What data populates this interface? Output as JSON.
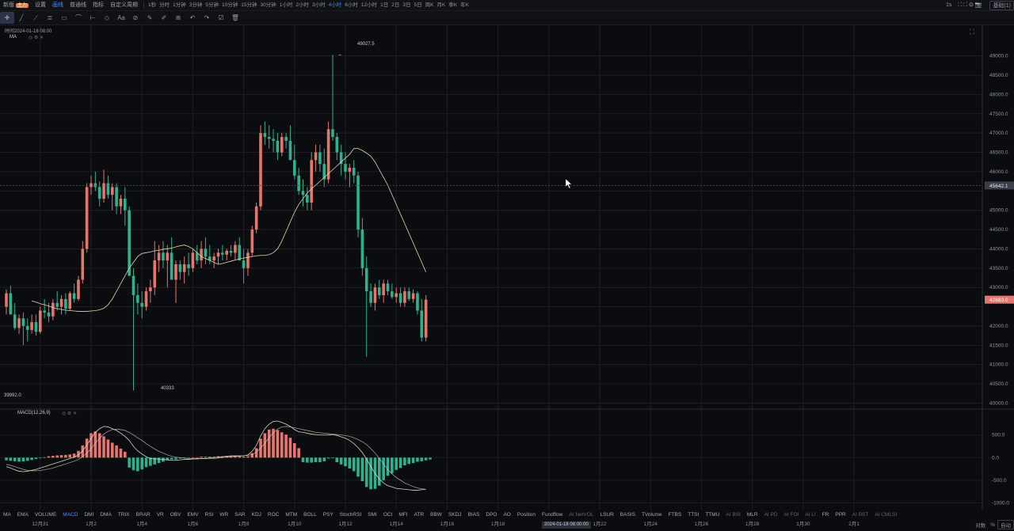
{
  "topbar": {
    "left_items": [
      {
        "label": "新版",
        "badge": "主力"
      },
      {
        "label": "设置"
      },
      {
        "label": "画线",
        "active": true
      },
      {
        "label": "普通线"
      },
      {
        "label": "指标"
      },
      {
        "label": "自定义周期"
      }
    ],
    "intervals": [
      "1秒",
      "分时",
      "1分钟",
      "3分钟",
      "5分钟",
      "10分钟",
      "15分钟",
      "30分钟",
      "1小时",
      "2小时",
      "3小时",
      "4小时",
      "6小时",
      "12小时",
      "1日",
      "2日",
      "3日",
      "5日",
      "周K",
      "月K",
      "季K",
      "年K"
    ],
    "active_interval": "4小时",
    "right_items": [
      "1s"
    ],
    "right_box": "基础(1)"
  },
  "chart_header": {
    "time_label": "时间2024-01-18 08:00",
    "ma_label": "MA",
    "max_price_label": "49027.5",
    "min_price_label": "40333",
    "last_low_label": "39992.0",
    "macd_label": "MACD(12,26,9)"
  },
  "chart_data": {
    "type": "candlestick",
    "title": "",
    "price_axis": {
      "ticks": [
        49000,
        48500,
        48000,
        47500,
        47000,
        46500,
        46000,
        45500,
        45000,
        44500,
        44000,
        43500,
        43000,
        42500,
        42000,
        41500,
        41000,
        40500,
        40000
      ],
      "tick_labels": [
        "49000.0",
        "48500.0",
        "48000.0",
        "47500.0",
        "47000.0",
        "46500.0",
        "46000.0",
        "45642.1",
        "45000.0",
        "44500.0",
        "44000.0",
        "43500.0",
        "43000.0",
        "42683.0",
        "42000.0",
        "41500.0",
        "41000.0",
        "40500.0",
        "40000.0"
      ],
      "range": [
        39990,
        49300
      ],
      "crosshair_price": "45642.1",
      "crosshair_value": 45642.1,
      "last_price": "42683.0",
      "last_value": 42683
    },
    "macd_axis": {
      "ticks": [
        500,
        0,
        -500,
        -1000
      ],
      "tick_labels": [
        "500.0",
        "0.0",
        "-500.0",
        "-1000.0"
      ],
      "range": [
        -1150,
        950
      ]
    },
    "date_ticks": [
      {
        "label": "12月31",
        "index": 8
      },
      {
        "label": "1月2",
        "index": 20
      },
      {
        "label": "1月4",
        "index": 32
      },
      {
        "label": "1月6",
        "index": 44
      },
      {
        "label": "1月8",
        "index": 56
      },
      {
        "label": "1月10",
        "index": 68
      },
      {
        "label": "1月12",
        "index": 80
      },
      {
        "label": "1月14",
        "index": 92
      },
      {
        "label": "1月16",
        "index": 104
      },
      {
        "label": "1月18",
        "index": 116
      },
      {
        "label": "1月20",
        "index": 128
      },
      {
        "label": "1月22",
        "index": 140
      },
      {
        "label": "1月24",
        "index": 152
      },
      {
        "label": "1月26",
        "index": 164
      },
      {
        "label": "1月28",
        "index": 176
      },
      {
        "label": "1月30",
        "index": 188
      },
      {
        "label": "2月1",
        "index": 200
      }
    ],
    "cursor_date": "2024-01-18 08:00:00",
    "candles": [
      [
        42500,
        42950,
        42300,
        42850
      ],
      [
        42850,
        43050,
        42700,
        42300
      ],
      [
        42300,
        42600,
        41900,
        41950
      ],
      [
        41950,
        42300,
        41800,
        42200
      ],
      [
        42200,
        42350,
        41500,
        42000
      ],
      [
        42000,
        42200,
        41600,
        41900
      ],
      [
        41900,
        42300,
        41800,
        42100
      ],
      [
        42100,
        42300,
        41750,
        41850
      ],
      [
        41850,
        42500,
        41800,
        42400
      ],
      [
        42400,
        42700,
        42200,
        42350
      ],
      [
        42350,
        42600,
        42100,
        42250
      ],
      [
        42250,
        42700,
        42150,
        42600
      ],
      [
        42600,
        42900,
        42400,
        42500
      ],
      [
        42500,
        42800,
        42300,
        42700
      ],
      [
        42700,
        42850,
        42300,
        42450
      ],
      [
        42450,
        42900,
        42400,
        42850
      ],
      [
        42850,
        43100,
        42600,
        42700
      ],
      [
        42700,
        43300,
        42650,
        43200
      ],
      [
        43200,
        44200,
        43100,
        44000
      ],
      [
        44000,
        45700,
        43900,
        45600
      ],
      [
        45600,
        45900,
        45400,
        45700
      ],
      [
        45700,
        46000,
        45500,
        45600
      ],
      [
        45600,
        45750,
        45100,
        45300
      ],
      [
        45300,
        46050,
        45200,
        45700
      ],
      [
        45700,
        45900,
        45300,
        45400
      ],
      [
        45400,
        45700,
        45000,
        45600
      ],
      [
        45600,
        45700,
        44900,
        45100
      ],
      [
        45100,
        45400,
        44900,
        45300
      ],
      [
        45300,
        45600,
        44600,
        45000
      ],
      [
        45000,
        45100,
        43400,
        43300
      ],
      [
        43300,
        43500,
        40333,
        42800
      ],
      [
        42800,
        43100,
        42300,
        42600
      ],
      [
        42600,
        42900,
        42200,
        42500
      ],
      [
        42500,
        43000,
        42400,
        42900
      ],
      [
        42900,
        43200,
        42600,
        43000
      ],
      [
        43000,
        44200,
        42800,
        43700
      ],
      [
        43700,
        44100,
        43400,
        43900
      ],
      [
        43900,
        44200,
        43500,
        43700
      ],
      [
        43700,
        44100,
        43000,
        43900
      ],
      [
        43900,
        44300,
        43600,
        43200
      ],
      [
        43200,
        43700,
        42600,
        43600
      ],
      [
        43600,
        43700,
        43200,
        43400
      ],
      [
        43400,
        43800,
        43100,
        43600
      ],
      [
        43600,
        43900,
        43300,
        43500
      ],
      [
        43500,
        44000,
        43400,
        43900
      ],
      [
        43900,
        44100,
        43600,
        43700
      ],
      [
        43700,
        44200,
        43500,
        44000
      ],
      [
        44000,
        44300,
        43600,
        43800
      ],
      [
        43800,
        44100,
        43600,
        43700
      ],
      [
        43700,
        43900,
        43500,
        43800
      ],
      [
        43800,
        44000,
        43600,
        43900
      ],
      [
        43900,
        44100,
        43700,
        43850
      ],
      [
        43850,
        44000,
        43700,
        43950
      ],
      [
        43950,
        44100,
        43800,
        43900
      ],
      [
        43900,
        44200,
        43700,
        44100
      ],
      [
        44100,
        44300,
        43800,
        43700
      ],
      [
        43700,
        44000,
        43100,
        43500
      ],
      [
        43500,
        44000,
        43300,
        43900
      ],
      [
        43900,
        44600,
        43800,
        44500
      ],
      [
        44500,
        45200,
        44400,
        45100
      ],
      [
        45100,
        47200,
        45000,
        47000
      ],
      [
        47000,
        47300,
        46700,
        46900
      ],
      [
        46900,
        47200,
        46600,
        46850
      ],
      [
        46850,
        47100,
        46500,
        46800
      ],
      [
        46800,
        47000,
        46300,
        46500
      ],
      [
        46500,
        47000,
        46400,
        46900
      ],
      [
        46900,
        47000,
        46600,
        46800
      ],
      [
        46800,
        47200,
        46600,
        46300
      ],
      [
        46300,
        46700,
        45800,
        45900
      ],
      [
        45900,
        46100,
        45400,
        45500
      ],
      [
        45500,
        45800,
        45100,
        45400
      ],
      [
        45400,
        45600,
        45000,
        45200
      ],
      [
        45200,
        46500,
        45000,
        46300
      ],
      [
        46300,
        46700,
        46000,
        46500
      ],
      [
        46500,
        46700,
        46000,
        46200
      ],
      [
        46200,
        46600,
        45600,
        45800
      ],
      [
        45800,
        47300,
        45700,
        47100
      ],
      [
        47100,
        49027.5,
        46800,
        46900
      ],
      [
        46900,
        47000,
        46300,
        46500
      ],
      [
        46500,
        46700,
        45900,
        46200
      ],
      [
        46200,
        46500,
        45800,
        46000
      ],
      [
        46000,
        46200,
        45600,
        46100
      ],
      [
        46100,
        46300,
        45700,
        45900
      ],
      [
        45900,
        46000,
        44300,
        44500
      ],
      [
        44500,
        44800,
        43300,
        43500
      ],
      [
        43500,
        43800,
        41200,
        42900
      ],
      [
        42900,
        43100,
        42500,
        42600
      ],
      [
        42600,
        43100,
        42400,
        43000
      ],
      [
        43000,
        43200,
        42700,
        42800
      ],
      [
        42800,
        43200,
        42600,
        43100
      ],
      [
        43100,
        43200,
        42800,
        42900
      ],
      [
        42900,
        43100,
        42700,
        42750
      ],
      [
        42750,
        43000,
        42600,
        42850
      ],
      [
        42850,
        43000,
        42500,
        42600
      ],
      [
        42600,
        43000,
        42500,
        42900
      ],
      [
        42900,
        43000,
        42650,
        42700
      ],
      [
        42700,
        42950,
        42600,
        42850
      ],
      [
        42850,
        42900,
        42300,
        42400
      ],
      [
        42400,
        42700,
        41600,
        41700
      ],
      [
        41700,
        42800,
        41600,
        42683
      ]
    ],
    "ma_series": {
      "name": "MA",
      "values": [
        42650,
        42620,
        42580,
        42550,
        42520,
        42480,
        42450,
        42430,
        42410,
        42400,
        42390,
        42380,
        42380,
        42380,
        42390,
        42400,
        42420,
        42460,
        42550,
        42700,
        42900,
        43100,
        43300,
        43500,
        43650,
        43800,
        43880,
        43900,
        43920,
        43950,
        43960,
        43990,
        44000,
        44020,
        44050,
        44080,
        44100,
        44060,
        44000,
        43900,
        43800,
        43750,
        43700,
        43650,
        43600,
        43620,
        43650,
        43680,
        43710,
        43740,
        43760,
        43780,
        43800,
        43820,
        43830,
        43830,
        43850,
        43900,
        44000,
        44200,
        44450,
        44700,
        44950,
        45150,
        45300,
        45450,
        45550,
        45650,
        45750,
        45850,
        45950,
        46050,
        46150,
        46250,
        46350,
        46450,
        46600,
        46600,
        46550,
        46480,
        46400,
        46250,
        46050,
        45850,
        45650,
        45400,
        45150,
        44900,
        44650,
        44400,
        44150,
        43900,
        43650,
        43400
      ]
    },
    "macd": {
      "hist": [
        -60,
        -70,
        -80,
        -90,
        -85,
        -70,
        -50,
        -30,
        -10,
        10,
        30,
        40,
        50,
        55,
        60,
        70,
        90,
        150,
        270,
        420,
        540,
        580,
        540,
        470,
        400,
        330,
        270,
        200,
        130,
        -220,
        -280,
        -300,
        -260,
        -210,
        -180,
        -150,
        -120,
        -90,
        -60,
        -40,
        -40,
        -20,
        -10,
        -10,
        0,
        0,
        20,
        20,
        20,
        20,
        30,
        30,
        30,
        30,
        40,
        30,
        20,
        30,
        100,
        210,
        420,
        540,
        620,
        640,
        610,
        560,
        510,
        440,
        320,
        210,
        -100,
        -110,
        -110,
        -100,
        -100,
        -80,
        -20,
        -10,
        -100,
        -150,
        -190,
        -240,
        -300,
        -420,
        -520,
        -650,
        -700,
        -690,
        -620,
        -500,
        -400,
        -350,
        -270,
        -230,
        -170,
        -140,
        -120,
        -90,
        -80,
        -60,
        -40
      ],
      "dif": [
        -200,
        -230,
        -270,
        -300,
        -310,
        -300,
        -280,
        -260,
        -230,
        -200,
        -170,
        -140,
        -110,
        -80,
        -50,
        -20,
        10,
        60,
        150,
        280,
        420,
        560,
        640,
        690,
        680,
        640,
        600,
        540,
        470,
        380,
        250,
        150,
        80,
        20,
        -20,
        -30,
        -30,
        -40,
        -50,
        -60,
        -60,
        -50,
        -40,
        -40,
        -30,
        -30,
        -20,
        -20,
        -10,
        0,
        10,
        20,
        30,
        40,
        40,
        40,
        40,
        60,
        140,
        270,
        480,
        640,
        740,
        800,
        810,
        780,
        740,
        690,
        620,
        570,
        560,
        540,
        520,
        510,
        500,
        500,
        500,
        510,
        490,
        460,
        430,
        380,
        310,
        220,
        110,
        -30,
        -200,
        -350,
        -470,
        -560,
        -620,
        -650,
        -680,
        -690,
        -700,
        -710,
        -720,
        -720,
        -710,
        -700
      ],
      "dea": [
        -150,
        -170,
        -200,
        -230,
        -260,
        -280,
        -290,
        -290,
        -280,
        -270,
        -250,
        -230,
        -200,
        -170,
        -140,
        -110,
        -80,
        -40,
        20,
        100,
        200,
        320,
        430,
        520,
        580,
        620,
        630,
        620,
        600,
        560,
        500,
        440,
        380,
        310,
        250,
        190,
        140,
        100,
        60,
        30,
        10,
        0,
        -10,
        -20,
        -20,
        -20,
        -20,
        -20,
        -20,
        -20,
        -10,
        0,
        10,
        20,
        30,
        30,
        40,
        50,
        70,
        120,
        210,
        320,
        440,
        550,
        630,
        680,
        690,
        680,
        660,
        640,
        620,
        600,
        580,
        560,
        550,
        540,
        530,
        520,
        510,
        500,
        490,
        470,
        440,
        400,
        350,
        290,
        200,
        100,
        -20,
        -140,
        -260,
        -360,
        -440,
        -500,
        -560,
        -600,
        -640,
        -670,
        -690,
        -700
      ]
    }
  },
  "indicators": [
    "MA",
    "EMA",
    "VOLUME",
    "MACD",
    "DMI",
    "DMA",
    "TRIX",
    "BRAR",
    "VR",
    "OBV",
    "EMV",
    "RSI",
    "WR",
    "SAR",
    "KDJ",
    "ROC",
    "MTM",
    "BOLL",
    "PSY",
    "StochRSI",
    "SMI",
    "OCI",
    "MFI",
    "ATR",
    "BBW",
    "SKDJ",
    "BIAS",
    "DPO",
    "AO",
    "Position",
    "Fundflow",
    "AI NetVOL",
    "LSUR",
    "BASIS",
    "TVolume",
    "FTBS",
    "TTSI",
    "TTMU",
    "AI BSI",
    "MLR",
    "AI PD",
    "AI FOI",
    "AI LI",
    "FR",
    "PPR",
    "AI BST",
    "AI CMLSI"
  ],
  "active_indicator": "MACD",
  "bottom_right": [
    "对数",
    "%",
    "自动"
  ],
  "colors": {
    "up": "#e5766b",
    "down": "#2bb38f",
    "ma": "#e6d7a5",
    "dif": "#ded3bf",
    "dea": "#cfc7b8",
    "grid": "#1c1f26"
  }
}
